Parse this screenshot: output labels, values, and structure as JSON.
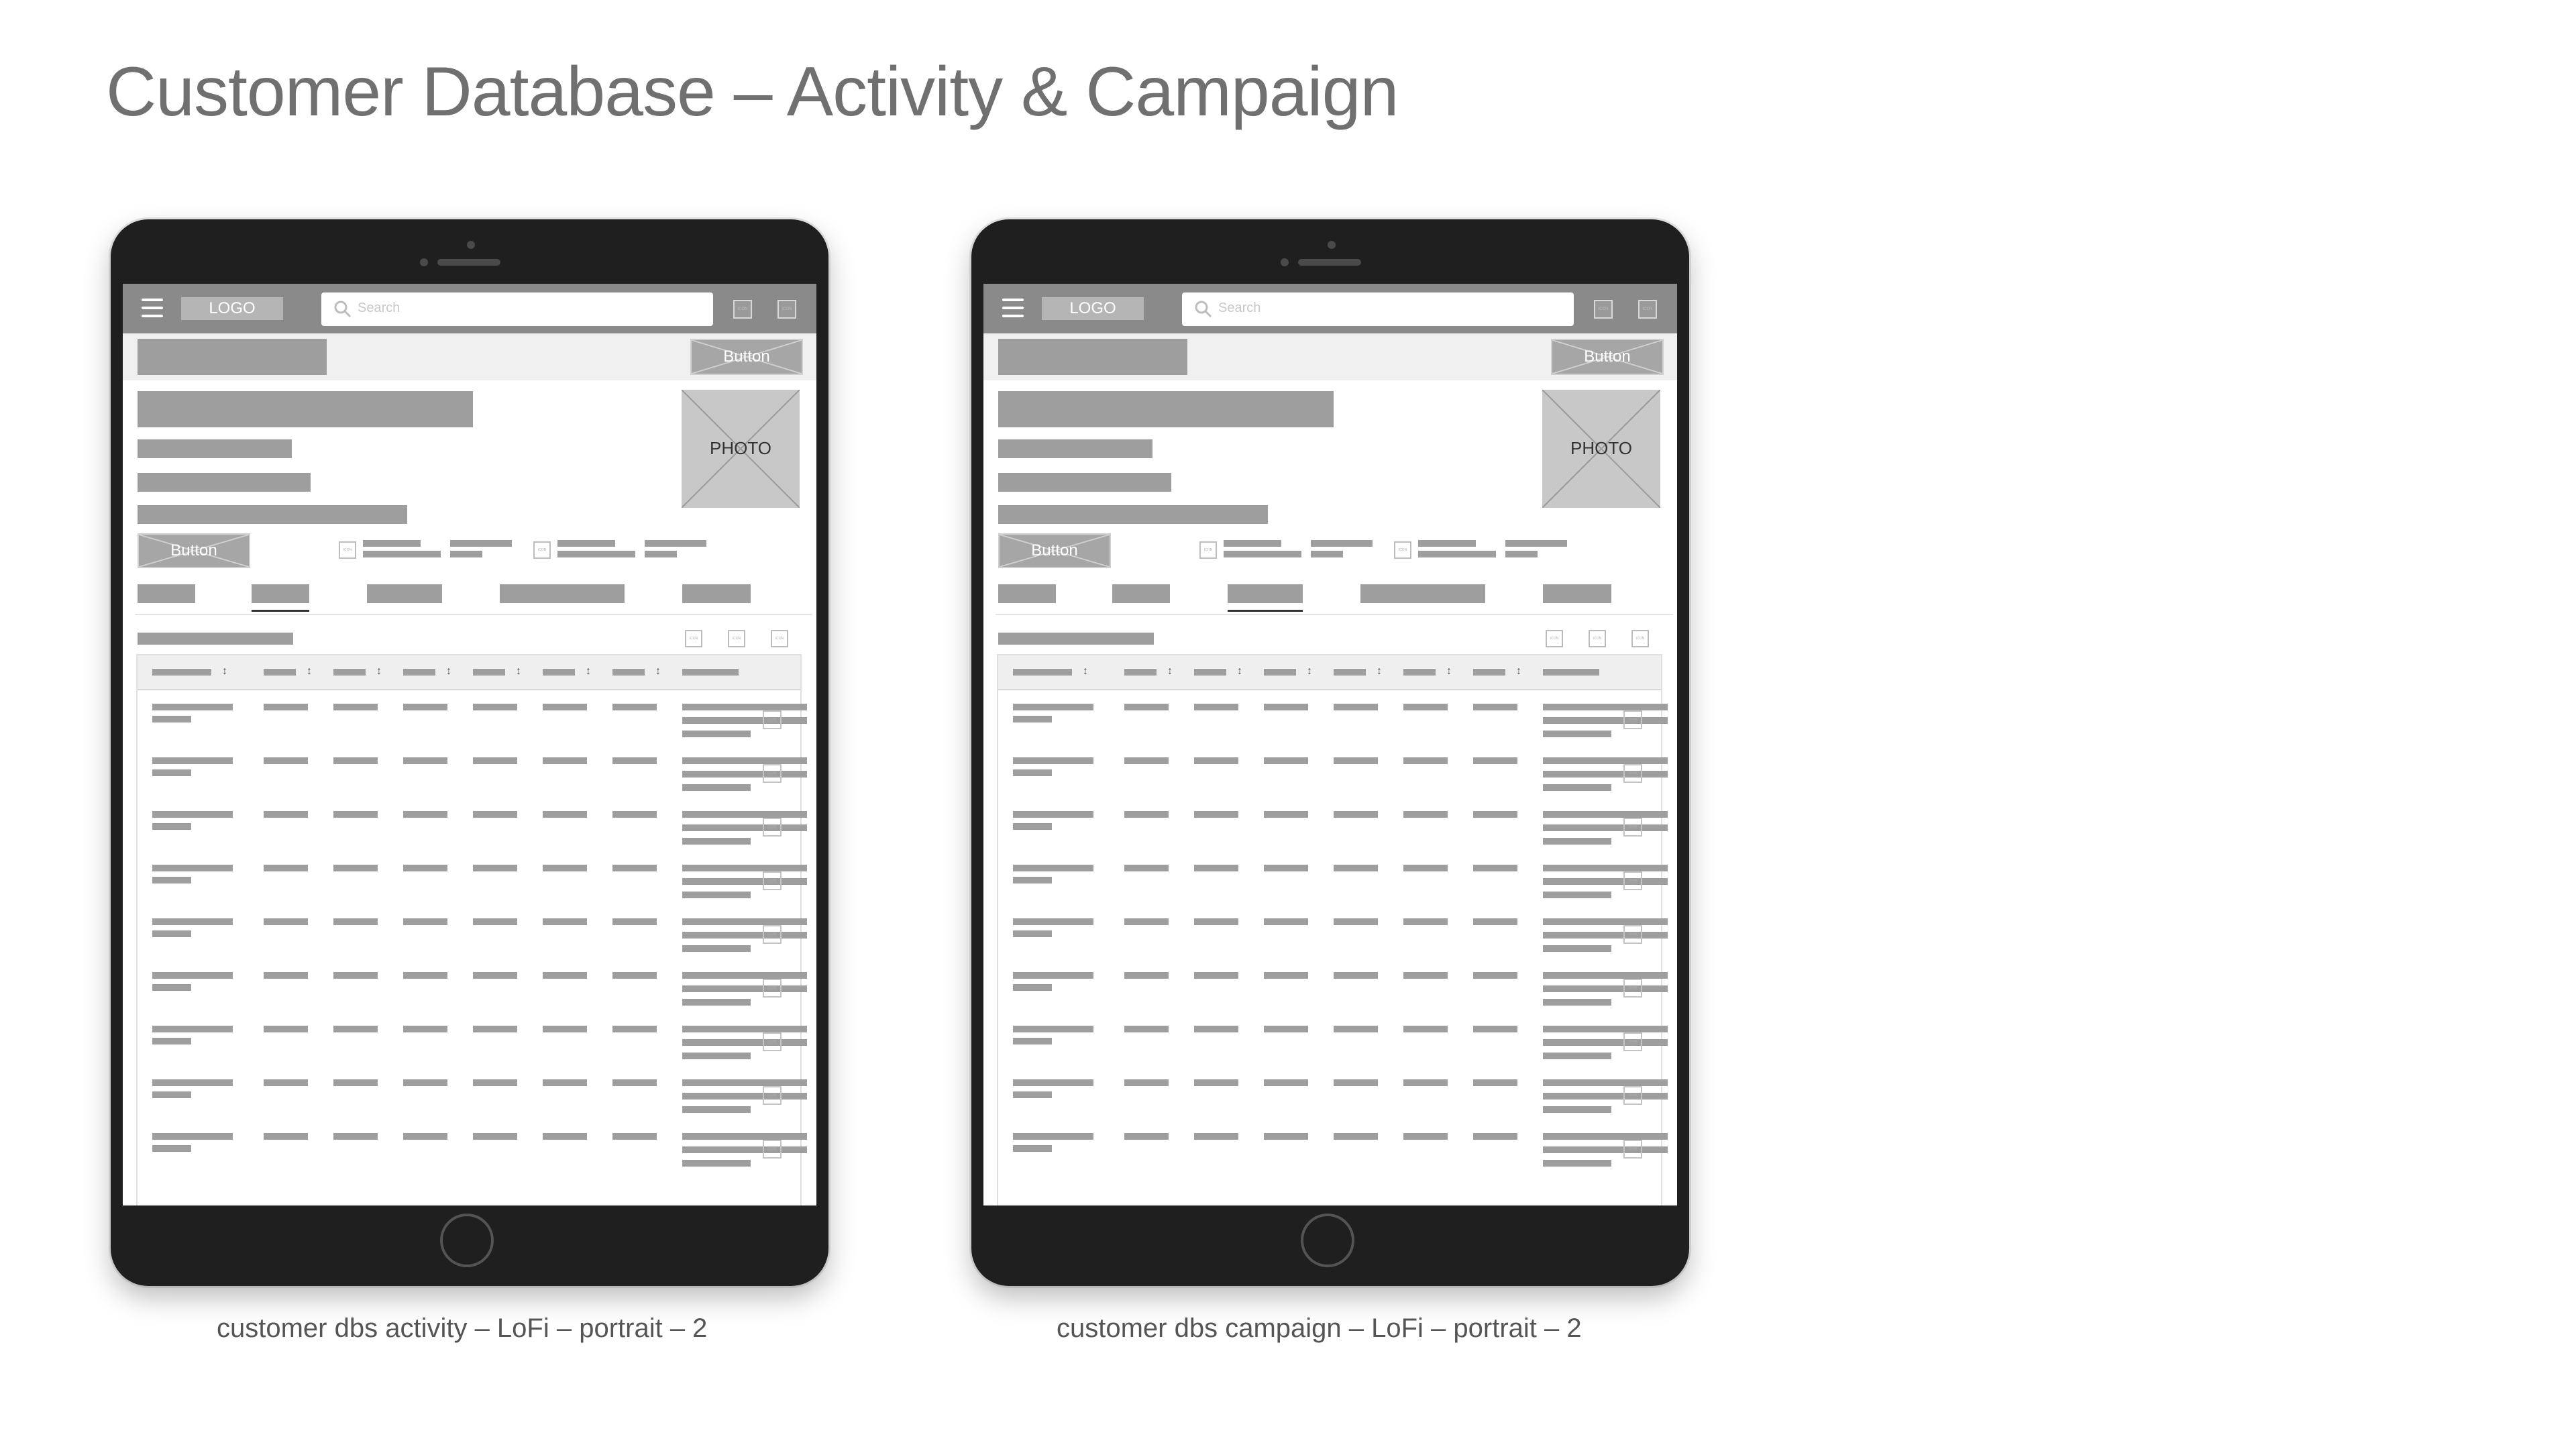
{
  "page": {
    "title": "Customer Database – Activity & Campaign"
  },
  "tablets": [
    {
      "caption": "customer dbs activity – LoFi – portrait – 2",
      "logo": "LOGO",
      "search_placeholder": "Search",
      "icon_text": "ICON",
      "button_label": "Button",
      "photo_label": "PHOTO",
      "active_tab": 1
    },
    {
      "caption": "customer dbs campaign – LoFi – portrait – 2",
      "logo": "LOGO",
      "search_placeholder": "Search",
      "icon_text": "ICON",
      "button_label": "Button",
      "photo_label": "PHOTO",
      "active_tab": 2
    }
  ]
}
